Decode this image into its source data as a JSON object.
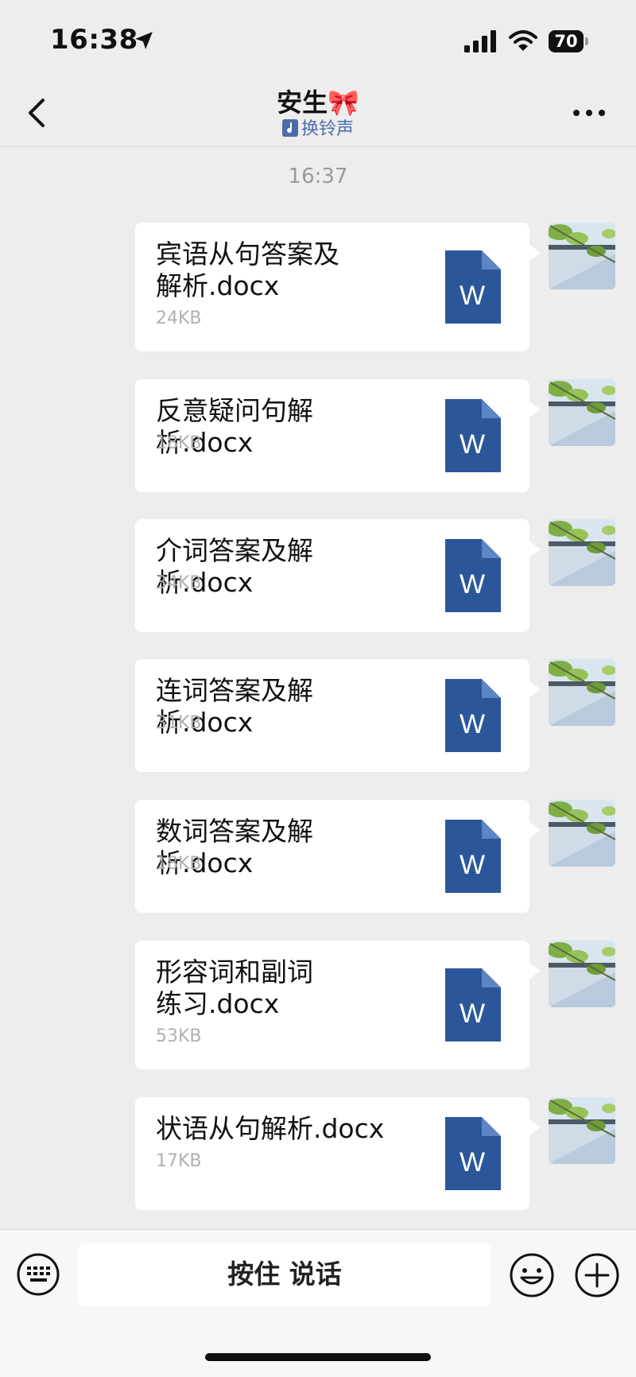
{
  "status_bar": {
    "time": "16:38",
    "battery": "70"
  },
  "nav": {
    "title": "安生🎀",
    "subtitle": "换铃声"
  },
  "chat": {
    "time_label": "16:37",
    "messages": [
      {
        "name": "宾语从句答案及解析.docx",
        "size": "24KB",
        "icon": "word-doc-icon"
      },
      {
        "name": "反意疑问句解析.docx",
        "size": "18KB",
        "icon": "word-doc-icon"
      },
      {
        "name": "介词答案及解析.docx",
        "size": "34KB",
        "icon": "word-doc-icon"
      },
      {
        "name": "连词答案及解析.docx",
        "size": "31KB",
        "icon": "word-doc-icon"
      },
      {
        "name": "数词答案及解析.docx",
        "size": "18KB",
        "icon": "word-doc-icon"
      },
      {
        "name": "形容词和副词练习.docx",
        "size": "53KB",
        "icon": "word-doc-icon"
      },
      {
        "name": "状语从句解析.docx",
        "size": "17KB",
        "icon": "word-doc-icon"
      }
    ]
  },
  "word_icon": {
    "letter": "W",
    "color": "#2b579a"
  },
  "input_bar": {
    "voice_label": "按住 说话"
  }
}
